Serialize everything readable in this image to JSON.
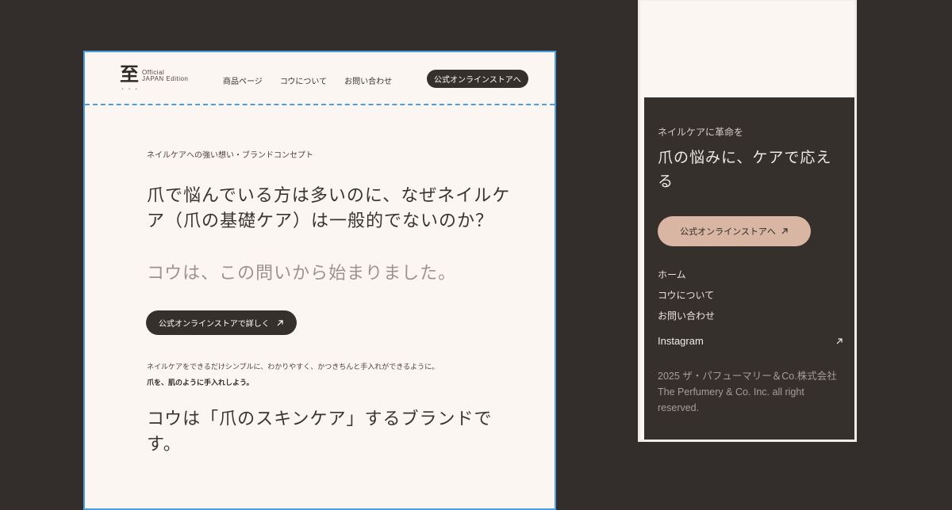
{
  "desktop": {
    "logo": {
      "mark": "至",
      "dots": "• • •",
      "line1": "Official",
      "line2": "JAPAN Edition"
    },
    "nav": [
      "商品ページ",
      "コウについて",
      "お問い合わせ"
    ],
    "store_button": "公式オンラインストアへ",
    "eyebrow": "ネイルケアへの強い想い・ブランドコンセプト",
    "headline": "爪で悩んでいる方は多いのに、なぜネイルケア（爪の基礎ケア）は一般的でないのか？",
    "subhead": "コウは、この問いから始まりました。",
    "cta": "公式オンラインストアで詳しく",
    "body1": "ネイルケアをできるだけシンプルに、わかりやすく、かつきちんと手入れができるように。",
    "body2": "爪を、肌のように手入れしよう。",
    "headline2": "コウは「爪のスキンケア」するブランドです。"
  },
  "mobile": {
    "eyebrow": "ネイルケアに革命を",
    "title": "爪の悩みに、ケアで応える",
    "button": "公式オンラインストアへ",
    "links": [
      "ホーム",
      "コウについて",
      "お問い合わせ"
    ],
    "instagram": "Instagram",
    "copyright": "2025 ザ・パフューマリー＆Co.株式会社 The Perfumery & Co. Inc. all right reserved."
  },
  "colors": {
    "background": "#332e2b",
    "page_bg": "#fcf6f2",
    "dark_button": "#36302d",
    "accent_button": "#d9b6a3",
    "selection_blue": "#4a9fe3"
  }
}
